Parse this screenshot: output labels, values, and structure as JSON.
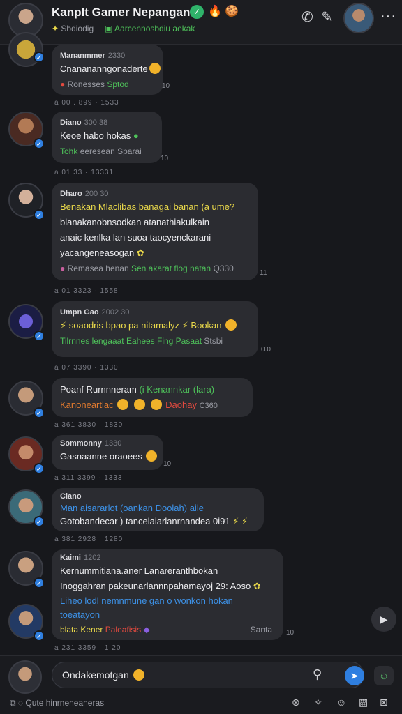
{
  "header": {
    "title": "Kanplt Gamer Nepangani",
    "subtitle_left": "Sbdiodig",
    "subtitle_right": "Aarcennosbdiu aekak",
    "badge_icon": "check-icon",
    "more_label": "···"
  },
  "messages": [
    {
      "name": "Mananmmer",
      "time": "2330",
      "lines": [
        "Cnanananngonaderte"
      ],
      "meta_left": "Ronesses",
      "meta_right": "Sptod",
      "ts_right": "10",
      "ts_below": "a 00 . 899 · 1533"
    },
    {
      "name": "Diano",
      "time": "300 38",
      "lines": [
        "Keoe habo hokas"
      ],
      "meta_left": "Tohk",
      "meta_right": "eeresean",
      "meta_extra": "Sparai",
      "ts_right": "10",
      "ts_below": "a 01 33 · 13331"
    },
    {
      "name": "Dharo",
      "time": "200 30",
      "lines": [
        "Benakan Mlaclibas banagai banan (a ume?",
        "blanakanobnsodkan atanathiakulkain",
        "anaic kenlka lan suoa taocyenckarani",
        "yacangeneasogan"
      ],
      "meta_left": "Remasea henan",
      "meta_right": "Sen akarat flog natan",
      "meta_extra": "Q330",
      "ts_right": "11",
      "ts_below": "a 01 3323 · 1558"
    },
    {
      "name": "Umpn Gao",
      "time": "2002 30",
      "lines": [
        "soaodris bpao pa nitamalyz",
        "Bookan"
      ],
      "meta_left": "Tilrnnes lengaaat",
      "meta_right": "Eahees Fing Pasaat",
      "meta_extra": "Stsbi",
      "ts_right": "0.0",
      "ts_below": "a 07 3390 · 1330"
    },
    {
      "name": "Poanf Rurnnneram",
      "time": "",
      "lines": [
        "Kanoneartlac"
      ],
      "title_extra": "(i Kenannkar (lara)",
      "meta_right": "Daohay",
      "meta_extra": "C360",
      "ts_right": "",
      "ts_below": "a 361 3830 · 1830"
    },
    {
      "name": "Sommonny",
      "time": "1330",
      "lines": [
        "Gasnaanne oraoees"
      ],
      "ts_right": "10",
      "ts_below": "a 311 3399 · 1333"
    },
    {
      "name": "Clano",
      "time": "",
      "lines": [
        "Man aisararlot (oankan Doolah) aile",
        "Gotobandecar ) tancelaiarlanrnandea 0i91"
      ],
      "ts_right": "",
      "ts_below": "a 381 2928 · 1280"
    },
    {
      "name": "Kaimi",
      "time": "1202",
      "lines": [
        "Kernummitiana.aner Lanareranthbokan",
        "Inoggahran pakeunarlannnpahamayoj 29: Aoso"
      ],
      "link_lines": [
        "Liheo lodl  nemnmune gan o wonkon hokan",
        "toeatayon"
      ],
      "meta_left": "blata Kener",
      "meta_right": "Paleafisis",
      "meta_extra": "Santa",
      "ts_right": "10",
      "ts_below": "a 231 3359 · 1 20"
    }
  ],
  "composer": {
    "placeholder": "Ondakemotgan",
    "bottom_label": "Qute hinrneneaneras"
  }
}
